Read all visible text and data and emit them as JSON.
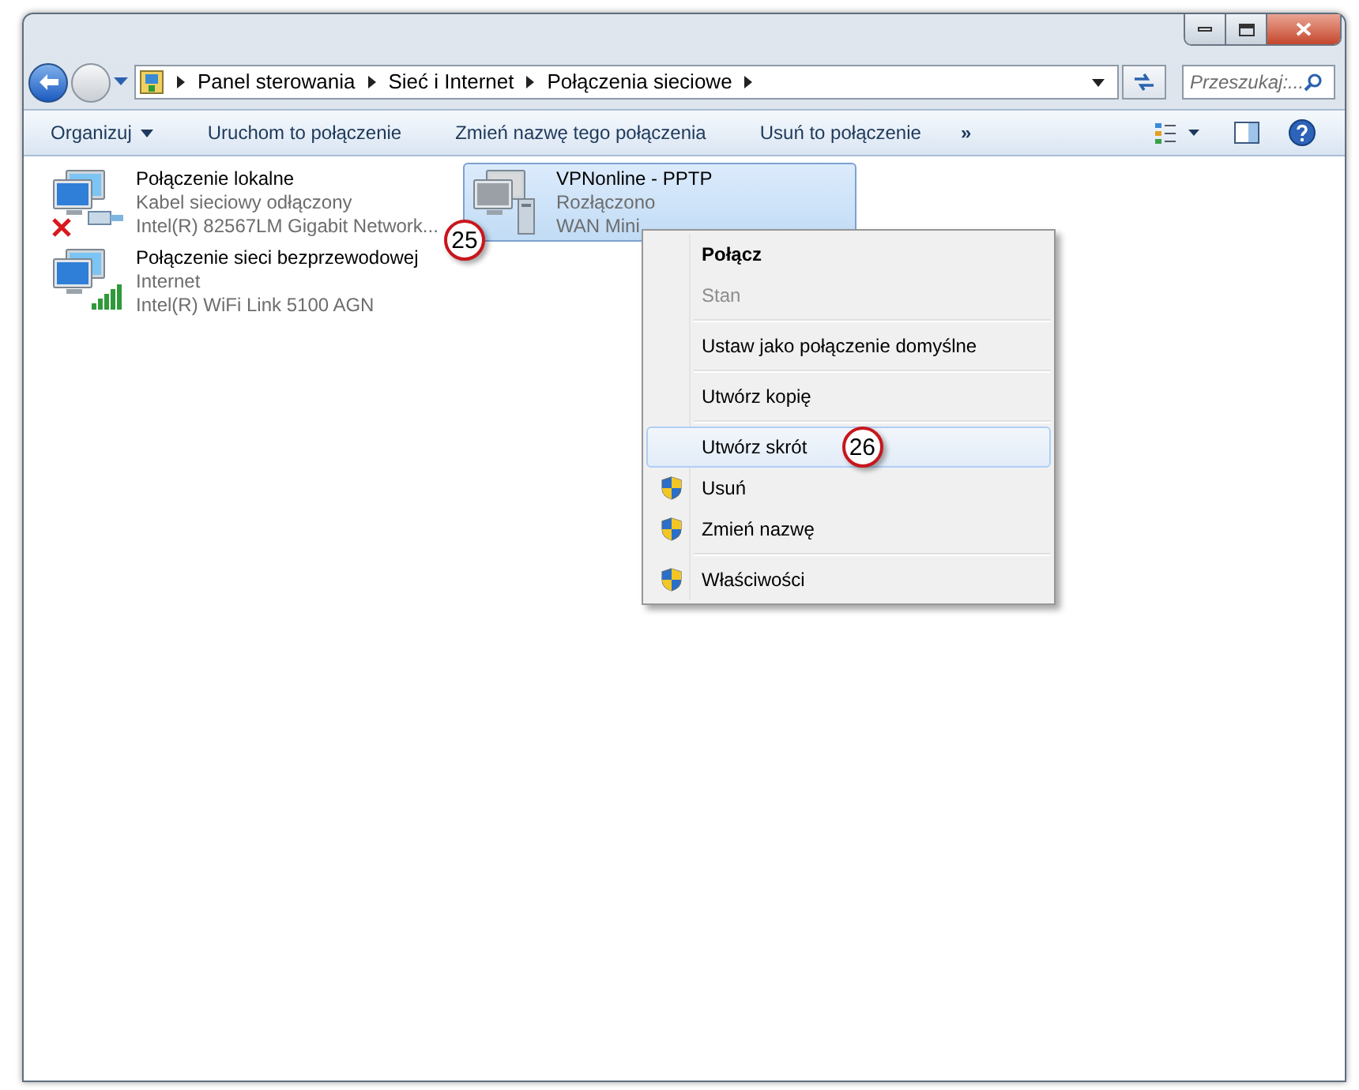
{
  "breadcrumb": [
    "Panel sterowania",
    "Sieć i Internet",
    "Połączenia sieciowe"
  ],
  "search": {
    "placeholder": "Przeszukaj:..."
  },
  "toolbar": {
    "items": [
      "Organizuj",
      "Uruchom to połączenie",
      "Zmień nazwę tego połączenia",
      "Usuń to połączenie"
    ],
    "more": "»"
  },
  "connections": [
    {
      "kind": "lan",
      "name": "Połączenie lokalne",
      "status": "Kabel sieciowy odłączony",
      "device": "Intel(R) 82567LM Gigabit Network...",
      "selected": false,
      "disconnected": true
    },
    {
      "kind": "wifi",
      "name": "Połączenie sieci bezprzewodowej",
      "status": "Internet",
      "device": "Intel(R) WiFi Link 5100 AGN",
      "selected": false,
      "disconnected": false
    },
    {
      "kind": "vpn",
      "name": "VPNonline - PPTP",
      "status": "Rozłączono",
      "device": "WAN Mini",
      "selected": true,
      "disconnected": false,
      "marker": "25"
    }
  ],
  "context_menu": [
    {
      "label": "Połącz",
      "default": true,
      "disabled": false,
      "shield": false,
      "selected": false,
      "separator_after": false
    },
    {
      "label": "Stan",
      "default": false,
      "disabled": true,
      "shield": false,
      "selected": false,
      "separator_after": true
    },
    {
      "label": "Ustaw jako połączenie domyślne",
      "default": false,
      "disabled": false,
      "shield": false,
      "selected": false,
      "separator_after": true
    },
    {
      "label": "Utwórz kopię",
      "default": false,
      "disabled": false,
      "shield": false,
      "selected": false,
      "separator_after": true
    },
    {
      "label": "Utwórz skrót",
      "default": false,
      "disabled": false,
      "shield": false,
      "selected": true,
      "separator_after": false,
      "marker": "26"
    },
    {
      "label": "Usuń",
      "default": false,
      "disabled": false,
      "shield": true,
      "selected": false,
      "separator_after": false
    },
    {
      "label": "Zmień nazwę",
      "default": false,
      "disabled": false,
      "shield": true,
      "selected": false,
      "separator_after": true
    },
    {
      "label": "Właściwości",
      "default": false,
      "disabled": false,
      "shield": true,
      "selected": false,
      "separator_after": false
    }
  ]
}
